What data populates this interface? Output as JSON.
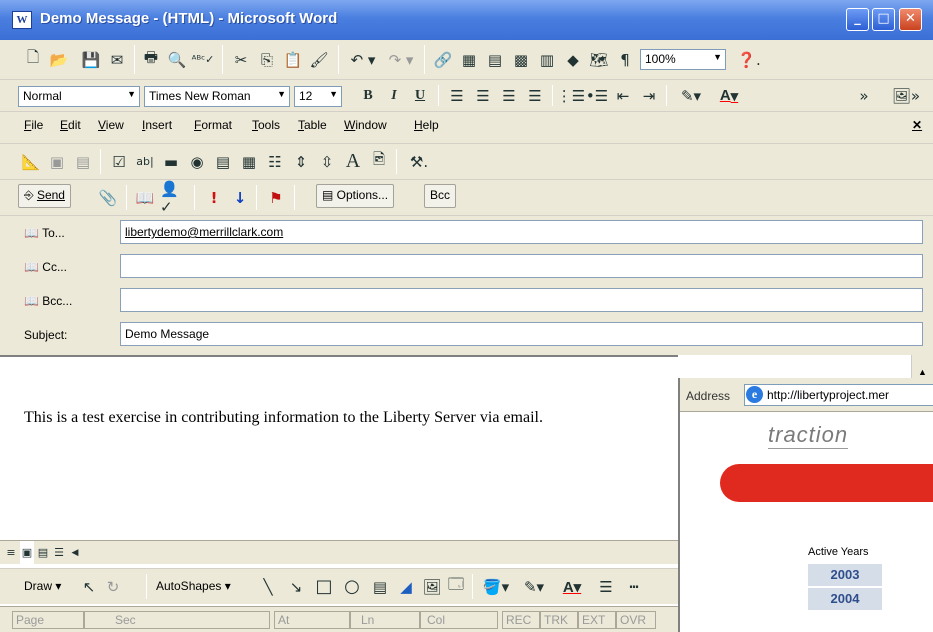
{
  "window": {
    "title": "Demo Message - (HTML) - Microsoft Word",
    "minimize": "_",
    "maximize": "□",
    "close": "✕"
  },
  "standard_toolbar": {
    "zoom": "100%",
    "icons": [
      "permission-icon",
      "open-icon",
      "save-icon",
      "email-icon",
      "print-icon",
      "print-preview-icon",
      "spelling-icon",
      "cut-icon",
      "copy-icon",
      "paste-icon",
      "format-painter-icon",
      "undo-icon",
      "redo-icon",
      "hyperlink-icon",
      "tables-borders-icon",
      "insert-table-icon",
      "insert-excel-icon",
      "columns-icon",
      "drawing-icon",
      "document-map-icon",
      "show-hide-icon",
      "help-icon"
    ]
  },
  "formatting_toolbar": {
    "style": "Normal",
    "font": "Times New Roman",
    "size": "12",
    "bold": "B",
    "italic": "I",
    "underline": "U",
    "font_color_label": "A"
  },
  "menu": {
    "items": [
      "File",
      "Edit",
      "View",
      "Insert",
      "Format",
      "Tools",
      "Table",
      "Window",
      "Help"
    ],
    "close": "✕"
  },
  "forms_toolbar": {
    "text_label": "A"
  },
  "mail_toolbar": {
    "send": "Send",
    "options": "Options...",
    "bcc": "Bcc"
  },
  "header": {
    "to_label": "To...",
    "to_value": "libertydemo@merrillclark.com",
    "cc_label": "Cc...",
    "cc_value": "",
    "bcc_label": "Bcc...",
    "bcc_value": "",
    "subject_label": "Subject:",
    "subject_value": "Demo Message"
  },
  "document": {
    "body": "This is a test exercise in contributing information to the Liberty Server via email."
  },
  "browser": {
    "address_label": "Address",
    "url": "http://libertyproject.mer",
    "logo_text": "traction",
    "active_years_label": "Active Years",
    "years": [
      "2003",
      "2004"
    ],
    "colors": {
      "red_band": "#e02a1f",
      "year_text": "#2f4e8c"
    }
  },
  "drawing_toolbar": {
    "draw": "Draw",
    "autoshapes": "AutoShapes"
  },
  "status_bar": {
    "page": "Page",
    "sec": "Sec",
    "at": "At",
    "ln": "Ln",
    "col": "Col",
    "rec": "REC",
    "trk": "TRK",
    "ext": "EXT",
    "ovr": "OVR"
  }
}
